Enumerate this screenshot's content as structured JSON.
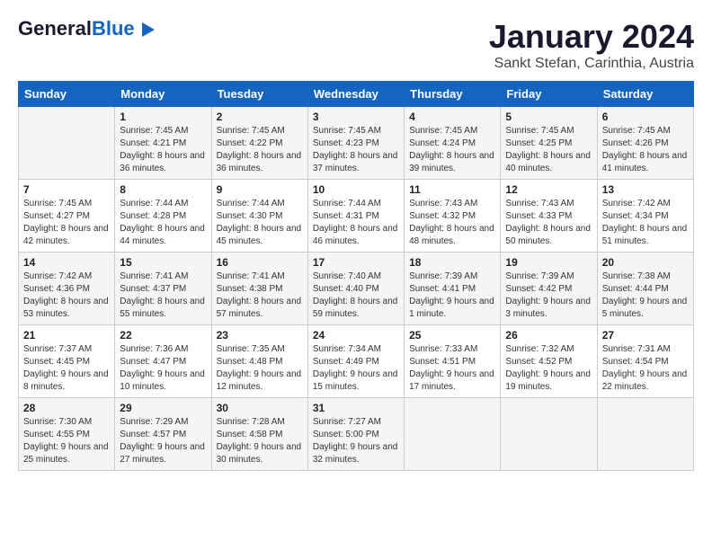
{
  "header": {
    "logo_general": "General",
    "logo_blue": "Blue",
    "title": "January 2024",
    "location": "Sankt Stefan, Carinthia, Austria"
  },
  "calendar": {
    "days_of_week": [
      "Sunday",
      "Monday",
      "Tuesday",
      "Wednesday",
      "Thursday",
      "Friday",
      "Saturday"
    ],
    "weeks": [
      [
        {
          "day": "",
          "sunrise": "",
          "sunset": "",
          "daylight": ""
        },
        {
          "day": "1",
          "sunrise": "Sunrise: 7:45 AM",
          "sunset": "Sunset: 4:21 PM",
          "daylight": "Daylight: 8 hours and 36 minutes."
        },
        {
          "day": "2",
          "sunrise": "Sunrise: 7:45 AM",
          "sunset": "Sunset: 4:22 PM",
          "daylight": "Daylight: 8 hours and 36 minutes."
        },
        {
          "day": "3",
          "sunrise": "Sunrise: 7:45 AM",
          "sunset": "Sunset: 4:23 PM",
          "daylight": "Daylight: 8 hours and 37 minutes."
        },
        {
          "day": "4",
          "sunrise": "Sunrise: 7:45 AM",
          "sunset": "Sunset: 4:24 PM",
          "daylight": "Daylight: 8 hours and 39 minutes."
        },
        {
          "day": "5",
          "sunrise": "Sunrise: 7:45 AM",
          "sunset": "Sunset: 4:25 PM",
          "daylight": "Daylight: 8 hours and 40 minutes."
        },
        {
          "day": "6",
          "sunrise": "Sunrise: 7:45 AM",
          "sunset": "Sunset: 4:26 PM",
          "daylight": "Daylight: 8 hours and 41 minutes."
        }
      ],
      [
        {
          "day": "7",
          "sunrise": "Sunrise: 7:45 AM",
          "sunset": "Sunset: 4:27 PM",
          "daylight": "Daylight: 8 hours and 42 minutes."
        },
        {
          "day": "8",
          "sunrise": "Sunrise: 7:44 AM",
          "sunset": "Sunset: 4:28 PM",
          "daylight": "Daylight: 8 hours and 44 minutes."
        },
        {
          "day": "9",
          "sunrise": "Sunrise: 7:44 AM",
          "sunset": "Sunset: 4:30 PM",
          "daylight": "Daylight: 8 hours and 45 minutes."
        },
        {
          "day": "10",
          "sunrise": "Sunrise: 7:44 AM",
          "sunset": "Sunset: 4:31 PM",
          "daylight": "Daylight: 8 hours and 46 minutes."
        },
        {
          "day": "11",
          "sunrise": "Sunrise: 7:43 AM",
          "sunset": "Sunset: 4:32 PM",
          "daylight": "Daylight: 8 hours and 48 minutes."
        },
        {
          "day": "12",
          "sunrise": "Sunrise: 7:43 AM",
          "sunset": "Sunset: 4:33 PM",
          "daylight": "Daylight: 8 hours and 50 minutes."
        },
        {
          "day": "13",
          "sunrise": "Sunrise: 7:42 AM",
          "sunset": "Sunset: 4:34 PM",
          "daylight": "Daylight: 8 hours and 51 minutes."
        }
      ],
      [
        {
          "day": "14",
          "sunrise": "Sunrise: 7:42 AM",
          "sunset": "Sunset: 4:36 PM",
          "daylight": "Daylight: 8 hours and 53 minutes."
        },
        {
          "day": "15",
          "sunrise": "Sunrise: 7:41 AM",
          "sunset": "Sunset: 4:37 PM",
          "daylight": "Daylight: 8 hours and 55 minutes."
        },
        {
          "day": "16",
          "sunrise": "Sunrise: 7:41 AM",
          "sunset": "Sunset: 4:38 PM",
          "daylight": "Daylight: 8 hours and 57 minutes."
        },
        {
          "day": "17",
          "sunrise": "Sunrise: 7:40 AM",
          "sunset": "Sunset: 4:40 PM",
          "daylight": "Daylight: 8 hours and 59 minutes."
        },
        {
          "day": "18",
          "sunrise": "Sunrise: 7:39 AM",
          "sunset": "Sunset: 4:41 PM",
          "daylight": "Daylight: 9 hours and 1 minute."
        },
        {
          "day": "19",
          "sunrise": "Sunrise: 7:39 AM",
          "sunset": "Sunset: 4:42 PM",
          "daylight": "Daylight: 9 hours and 3 minutes."
        },
        {
          "day": "20",
          "sunrise": "Sunrise: 7:38 AM",
          "sunset": "Sunset: 4:44 PM",
          "daylight": "Daylight: 9 hours and 5 minutes."
        }
      ],
      [
        {
          "day": "21",
          "sunrise": "Sunrise: 7:37 AM",
          "sunset": "Sunset: 4:45 PM",
          "daylight": "Daylight: 9 hours and 8 minutes."
        },
        {
          "day": "22",
          "sunrise": "Sunrise: 7:36 AM",
          "sunset": "Sunset: 4:47 PM",
          "daylight": "Daylight: 9 hours and 10 minutes."
        },
        {
          "day": "23",
          "sunrise": "Sunrise: 7:35 AM",
          "sunset": "Sunset: 4:48 PM",
          "daylight": "Daylight: 9 hours and 12 minutes."
        },
        {
          "day": "24",
          "sunrise": "Sunrise: 7:34 AM",
          "sunset": "Sunset: 4:49 PM",
          "daylight": "Daylight: 9 hours and 15 minutes."
        },
        {
          "day": "25",
          "sunrise": "Sunrise: 7:33 AM",
          "sunset": "Sunset: 4:51 PM",
          "daylight": "Daylight: 9 hours and 17 minutes."
        },
        {
          "day": "26",
          "sunrise": "Sunrise: 7:32 AM",
          "sunset": "Sunset: 4:52 PM",
          "daylight": "Daylight: 9 hours and 19 minutes."
        },
        {
          "day": "27",
          "sunrise": "Sunrise: 7:31 AM",
          "sunset": "Sunset: 4:54 PM",
          "daylight": "Daylight: 9 hours and 22 minutes."
        }
      ],
      [
        {
          "day": "28",
          "sunrise": "Sunrise: 7:30 AM",
          "sunset": "Sunset: 4:55 PM",
          "daylight": "Daylight: 9 hours and 25 minutes."
        },
        {
          "day": "29",
          "sunrise": "Sunrise: 7:29 AM",
          "sunset": "Sunset: 4:57 PM",
          "daylight": "Daylight: 9 hours and 27 minutes."
        },
        {
          "day": "30",
          "sunrise": "Sunrise: 7:28 AM",
          "sunset": "Sunset: 4:58 PM",
          "daylight": "Daylight: 9 hours and 30 minutes."
        },
        {
          "day": "31",
          "sunrise": "Sunrise: 7:27 AM",
          "sunset": "Sunset: 5:00 PM",
          "daylight": "Daylight: 9 hours and 32 minutes."
        },
        {
          "day": "",
          "sunrise": "",
          "sunset": "",
          "daylight": ""
        },
        {
          "day": "",
          "sunrise": "",
          "sunset": "",
          "daylight": ""
        },
        {
          "day": "",
          "sunrise": "",
          "sunset": "",
          "daylight": ""
        }
      ]
    ]
  }
}
